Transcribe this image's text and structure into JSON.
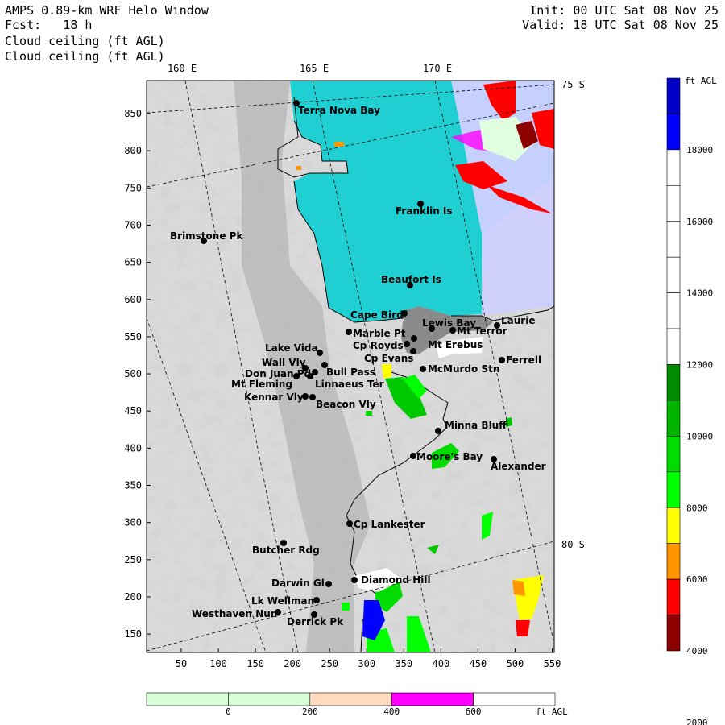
{
  "header": {
    "model": "AMPS 0.89-km WRF Helo Window",
    "forecast": "Fcst:   18 h",
    "field_line_1": "Cloud ceiling (ft AGL)",
    "field_line_2": "Cloud ceiling (ft AGL)",
    "init": "Init: 00 UTC Sat 08 Nov 25",
    "valid": "Valid: 18 UTC Sat 08 Nov 25"
  },
  "map": {
    "lon_labels": [
      "160 E",
      "165 E",
      "170 E"
    ],
    "lat_labels": [
      "75 S",
      "80 S"
    ],
    "y_ticks": [
      "850",
      "800",
      "750",
      "700",
      "650",
      "600",
      "550",
      "500",
      "450",
      "400",
      "350",
      "300",
      "250",
      "200",
      "150"
    ],
    "x_ticks": [
      "50",
      "100",
      "150",
      "200",
      "250",
      "300",
      "350",
      "400",
      "450",
      "500",
      "550"
    ],
    "stations": [
      {
        "name": "Terra Nova Bay"
      },
      {
        "name": "Franklin Is"
      },
      {
        "name": "Brimstone Pk"
      },
      {
        "name": "Beaufort Is"
      },
      {
        "name": "Cape Bird"
      },
      {
        "name": "Lewis Bay"
      },
      {
        "name": "Laurie"
      },
      {
        "name": "Mt Terror"
      },
      {
        "name": "Marble Pt"
      },
      {
        "name": "Cp Royds"
      },
      {
        "name": "Mt Erebus"
      },
      {
        "name": "Lake Vida"
      },
      {
        "name": "Cp Evans"
      },
      {
        "name": "Ferrell"
      },
      {
        "name": "Wall Vly"
      },
      {
        "name": "Bull Pass"
      },
      {
        "name": "McMurdo Stn"
      },
      {
        "name": "Don Juan Pd"
      },
      {
        "name": "Mt Fleming"
      },
      {
        "name": "Linnaeus Ter"
      },
      {
        "name": "Kennar Vly"
      },
      {
        "name": "Beacon Vly"
      },
      {
        "name": "Minna Bluff"
      },
      {
        "name": "Moore's Bay"
      },
      {
        "name": "Alexander"
      },
      {
        "name": "Cp Lankester"
      },
      {
        "name": "Butcher Rdg"
      },
      {
        "name": "Darwin Gl"
      },
      {
        "name": "Diamond Hill"
      },
      {
        "name": "Lk Wellman"
      },
      {
        "name": "Westhaven Nun"
      },
      {
        "name": "Derrick Pk"
      }
    ]
  },
  "colorbar_right": {
    "unit": "ft AGL",
    "labels": [
      "18000",
      "16000",
      "14000",
      "12000",
      "10000",
      "8000",
      "6000",
      "4000",
      "2000"
    ],
    "colors": [
      "#0000c8",
      "#0000ff",
      "#ffffff",
      "#ffffff",
      "#ffffff",
      "#ffffff",
      "#ffffff",
      "#ffffff",
      "#008c00",
      "#00b400",
      "#00dc00",
      "#00ff00",
      "#ffff00",
      "#ff9600",
      "#ff0000",
      "#8c0000"
    ]
  },
  "colorbar_bottom": {
    "unit": "ft AGL",
    "labels": [
      "0",
      "200",
      "400",
      "600"
    ],
    "colors": [
      "#d8ffd8",
      "#d8ffd8",
      "#ffdcc0",
      "#ff00ff",
      "#ffffff"
    ]
  }
}
